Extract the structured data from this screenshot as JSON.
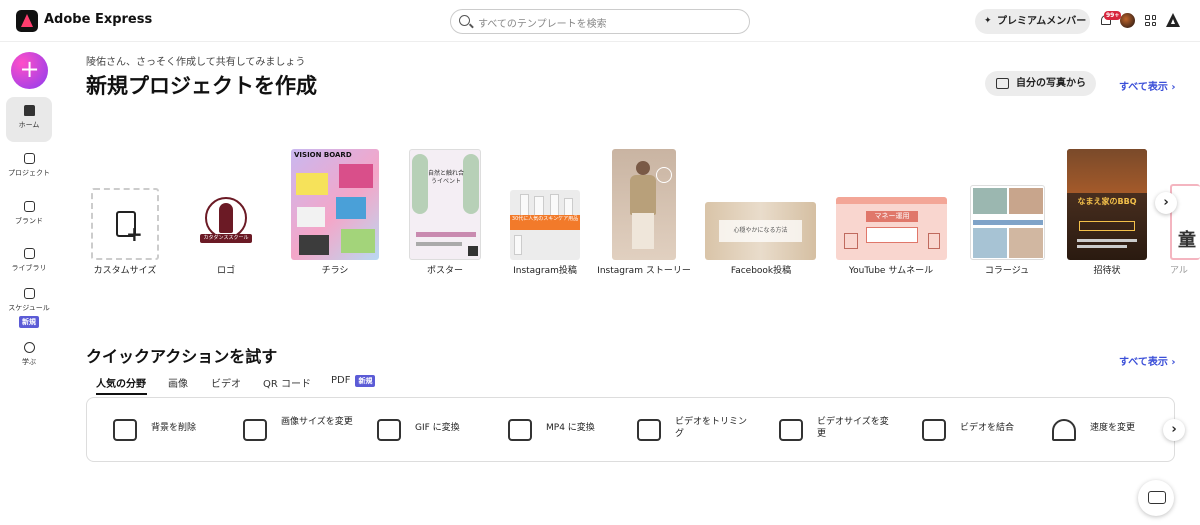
{
  "app": {
    "title": "Adobe Express"
  },
  "search": {
    "placeholder": "すべてのテンプレートを検索"
  },
  "header": {
    "premium_label": "プレミアムメンバー",
    "notification_count": "99+"
  },
  "sidebar": {
    "create_label": "+",
    "items": [
      {
        "label": "ホーム",
        "active": true
      },
      {
        "label": "プロジェクト"
      },
      {
        "label": "ブランド"
      },
      {
        "label": "ライブラリ"
      },
      {
        "label": "スケジュール",
        "badge": "新規"
      },
      {
        "label": "学ぶ"
      }
    ]
  },
  "main": {
    "greeting": "陵佑さん、さっそく作成して共有してみましょう",
    "title": "新規プロジェクトを作成",
    "from_photo_label": "自分の写真から",
    "see_all_label": "すべて表示",
    "templates": [
      {
        "label": "カスタムサイズ"
      },
      {
        "label": "ロゴ",
        "preview_text": "カタダンススクール"
      },
      {
        "label": "チラシ",
        "preview_text": "VISION BOARD"
      },
      {
        "label": "ポスター",
        "preview_text": "自然と触れ合うイベント"
      },
      {
        "label": "Instagram投稿",
        "preview_text": "30代に人気のスキンケア用品"
      },
      {
        "label": "Instagram ストーリー"
      },
      {
        "label": "Facebook投稿",
        "preview_text": "心穏やかになる方法"
      },
      {
        "label": "YouTube サムネール",
        "preview_text": "マネー運用"
      },
      {
        "label": "コラージュ"
      },
      {
        "label": "招待状",
        "preview_text": "なまえ家のBBQ"
      },
      {
        "label": "アル",
        "preview_text": "童"
      }
    ]
  },
  "quick": {
    "title": "クイックアクションを試す",
    "see_all_label": "すべて表示",
    "tabs": [
      {
        "label": "人気の分野",
        "active": true
      },
      {
        "label": "画像"
      },
      {
        "label": "ビデオ"
      },
      {
        "label": "QR コード"
      },
      {
        "label": "PDF",
        "badge": "新規"
      }
    ],
    "actions": [
      {
        "label": "背景を削除",
        "icon": "image-icon"
      },
      {
        "label": "画像サイズを変更",
        "icon": "resize-image-icon"
      },
      {
        "label": "GIF に変換",
        "icon": "gif-icon"
      },
      {
        "label": "MP4 に変換",
        "icon": "mp4-icon"
      },
      {
        "label": "ビデオをトリミング",
        "icon": "trim-video-icon"
      },
      {
        "label": "ビデオサイズを変更",
        "icon": "resize-video-icon"
      },
      {
        "label": "ビデオを結合",
        "icon": "merge-video-icon"
      },
      {
        "label": "速度を変更",
        "icon": "speed-icon"
      }
    ]
  },
  "colors": {
    "accent": "#3b4fd8",
    "create_button": "#a83cf0",
    "badge": "#5b5bd6"
  }
}
